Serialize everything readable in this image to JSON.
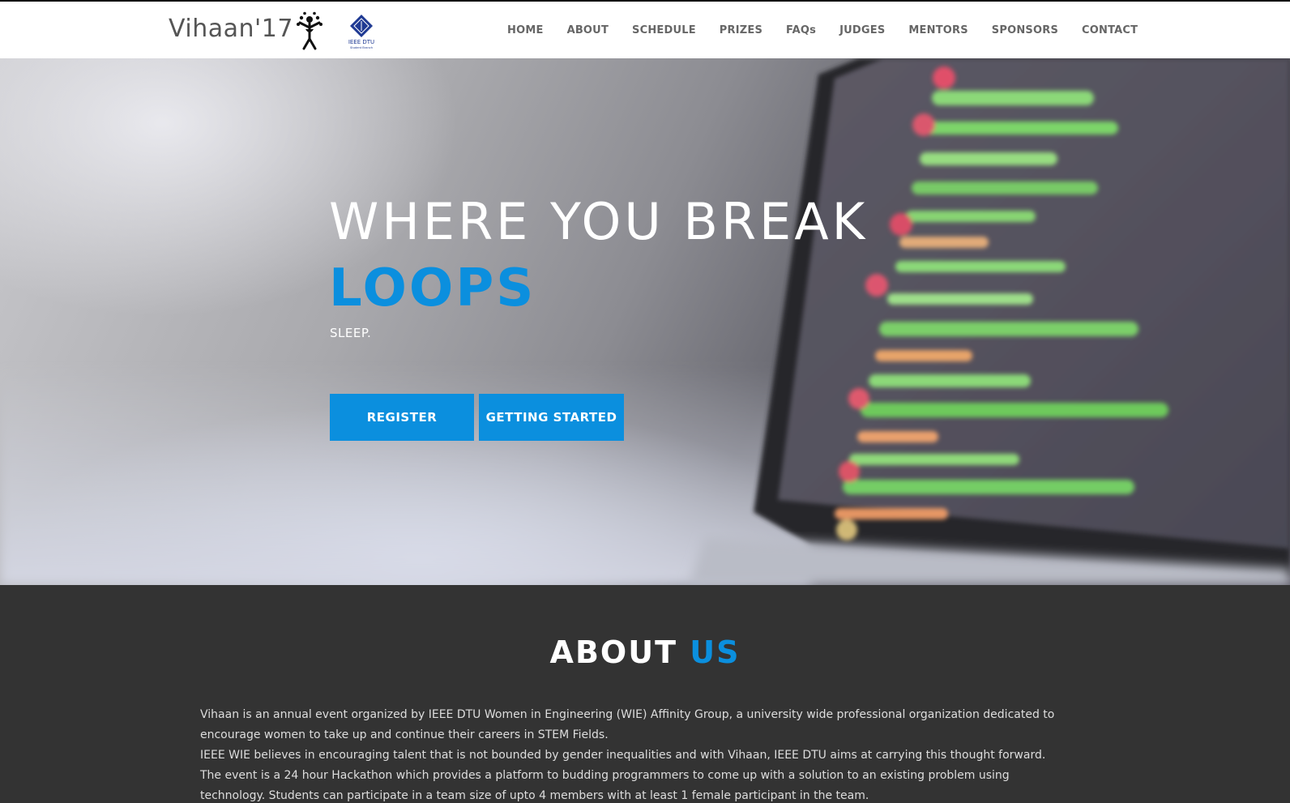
{
  "brand": {
    "name": "Vihaan'17",
    "ieee_text": "IEEE DTU",
    "ieee_subtext": "Student Branch"
  },
  "nav": {
    "items": [
      {
        "label": "HOME"
      },
      {
        "label": "ABOUT"
      },
      {
        "label": "SCHEDULE"
      },
      {
        "label": "PRIZES"
      },
      {
        "label": "FAQs"
      },
      {
        "label": "JUDGES"
      },
      {
        "label": "MENTORS"
      },
      {
        "label": "SPONSORS"
      },
      {
        "label": "CONTACT"
      }
    ]
  },
  "hero": {
    "title": "WHERE YOU BREAK",
    "accent": "LOOPS",
    "subtitle": "SLEEP.",
    "register_label": "REGISTER",
    "getting_started_label": "GETTING STARTED"
  },
  "about": {
    "heading_main": "ABOUT",
    "heading_accent": "US",
    "paragraph1": "Vihaan is an annual event organized by IEEE DTU Women in Engineering (WIE) Affinity Group, a university wide professional organization dedicated to encourage women to take up and continue their careers in STEM Fields.",
    "paragraph2": "IEEE WIE believes in encouraging talent that is not bounded by gender inequalities and with Vihaan, IEEE DTU aims at carrying this thought forward. The event is a 24 hour Hackathon which provides a platform to budding programmers to come up with a solution to an existing problem using technology. Students can participate in a team size of upto 4 members with at least 1 female participant in the team."
  },
  "colors": {
    "accent": "#0b8fde",
    "nav_text": "#666666",
    "about_bg": "#333333"
  }
}
